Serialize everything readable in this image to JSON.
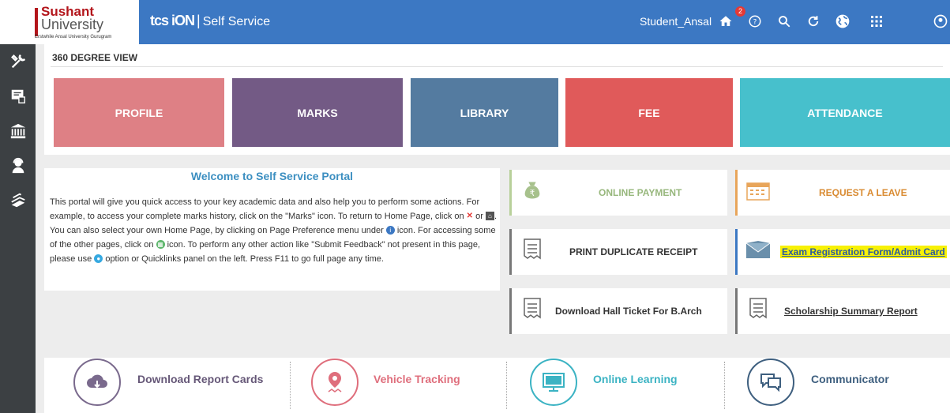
{
  "header": {
    "logo_main": "Sushant",
    "logo_sub": "University",
    "logo_tagline": "Erstwhile Ansal University Gurugram",
    "brand_main": "tcs iON",
    "brand_sep": "|",
    "brand_sub": "Self Service",
    "username": "Student_Ansal",
    "notification_count": "2",
    "icons": [
      "home-icon",
      "help-icon",
      "search-icon",
      "refresh-icon",
      "globe-icon",
      "apps-grid-icon",
      "account-icon"
    ]
  },
  "sidebar": {
    "items": [
      "tools-icon",
      "feedback-icon",
      "institution-icon",
      "support-icon",
      "books-icon"
    ]
  },
  "view360": {
    "title": "360 DEGREE VIEW",
    "tiles": [
      {
        "label": "PROFILE",
        "color": "#de8085"
      },
      {
        "label": "MARKS",
        "color": "#735a85"
      },
      {
        "label": "LIBRARY",
        "color": "#547ba0"
      },
      {
        "label": "FEE",
        "color": "#e05a5a"
      },
      {
        "label": "ATTENDANCE",
        "color": "#47c0cc"
      }
    ]
  },
  "welcome": {
    "title": "Welcome to Self Service Portal",
    "p1": "This portal will give you quick access to your key academic data and also help you to perform some actions. For example, to access your complete marks history, click on the \"Marks\" icon. To return to Home Page, click on ",
    "p2": " or ",
    "p3": ". You can also select your own Home Page, by clicking on Page Preference menu under ",
    "p4": " icon. For accessing some of the other pages, click on ",
    "p5": " icon. To perform any other action like \"Submit Feedback\" not present in this page, please use ",
    "p6": " option or Quicklinks panel on the left. Press F11 to go full page any time."
  },
  "quick": {
    "online_payment": "ONLINE PAYMENT",
    "request_leave": "REQUEST A LEAVE",
    "print_receipt": "PRINT DUPLICATE RECEIPT",
    "exam_registration": "Exam Registration Form/Admit Card",
    "hall_ticket": "Download Hall Ticket For B.Arch",
    "scholarship": "Scholarship Summary Report"
  },
  "bottom": {
    "report_cards": "Download Report Cards",
    "vehicle": "Vehicle Tracking",
    "online_learning": "Online Learning",
    "communicator": "Communicator"
  }
}
